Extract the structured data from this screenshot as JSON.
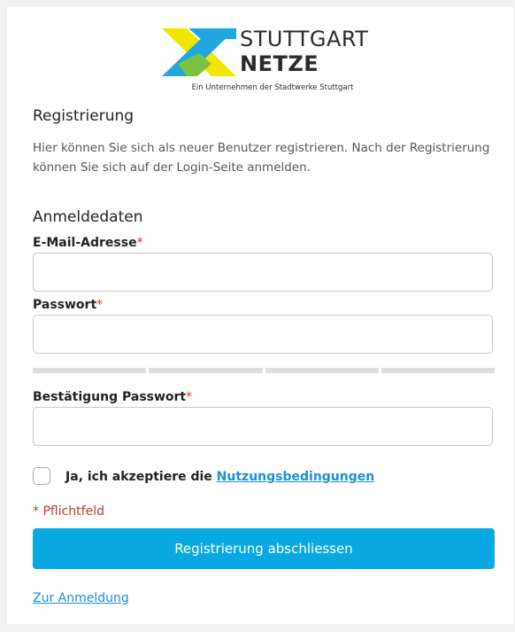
{
  "logo": {
    "word1": "STUTTGART",
    "word2": "NETZE",
    "tagline": "Ein Unternehmen der Stadtwerke Stuttgart",
    "colors": {
      "blue": "#1fa8e0",
      "yellow": "#f2e500",
      "green": "#7cc242"
    }
  },
  "registration": {
    "title": "Registrierung",
    "intro": "Hier können Sie sich als neuer Benutzer registrieren. Nach der Registrierung können Sie sich auf der Login-Seite anmelden."
  },
  "credentials": {
    "title": "Anmeldedaten",
    "email_label": "E-Mail-Adresse",
    "email_value": "",
    "password_label": "Passwort",
    "password_value": "",
    "confirm_label": "Bestätigung Passwort",
    "confirm_value": "",
    "required_marker": "*"
  },
  "terms": {
    "checked": false,
    "text": "Ja, ich akzeptiere die ",
    "link": "Nutzungsbedingungen"
  },
  "mandatory_note": "* Pflichtfeld",
  "submit_label": "Registrierung abschliessen",
  "back_link": "Zur Anmeldung",
  "colors": {
    "accent": "#0aa8e0",
    "link": "#1a8fd8",
    "required": "#c0392b"
  }
}
